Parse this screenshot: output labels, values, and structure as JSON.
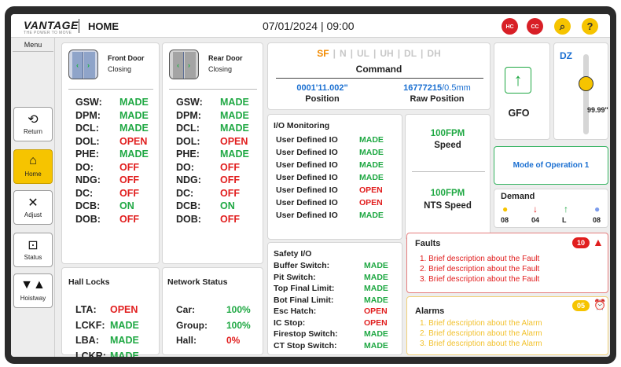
{
  "header": {
    "logo": "VANTAGE",
    "logo_sub": "THE POWER TO MOVE",
    "title": "HOME",
    "datetime": "07/01/2024 | 09:00",
    "badges": [
      {
        "label": "HC",
        "color": "#d81f26",
        "icon": "lock-icon"
      },
      {
        "label": "CC",
        "color": "#d81f26",
        "icon": "lock-icon"
      },
      {
        "label": "⌕",
        "color": "#f6c400",
        "icon": "search-icon"
      },
      {
        "label": "?",
        "color": "#f6c400",
        "icon": "help-icon"
      }
    ]
  },
  "menu": {
    "title": "Menu",
    "items": [
      {
        "label": "Return",
        "icon": "return-icon"
      },
      {
        "label": "Home",
        "icon": "home-icon",
        "active": true
      },
      {
        "label": "Adjust",
        "icon": "tools-icon"
      },
      {
        "label": "Status",
        "icon": "status-icon"
      },
      {
        "label": "Hoistway",
        "icon": "hoistway-icon"
      }
    ]
  },
  "front_door": {
    "name": "Front Door",
    "state": "Closing",
    "signals": [
      {
        "k": "GSW:",
        "v": "MADE",
        "c": "g"
      },
      {
        "k": "DPM:",
        "v": "MADE",
        "c": "g"
      },
      {
        "k": "DCL:",
        "v": "MADE",
        "c": "g"
      },
      {
        "k": "DOL:",
        "v": "OPEN",
        "c": "r"
      },
      {
        "k": "PHE:",
        "v": "MADE",
        "c": "g"
      },
      {
        "k": "DO:",
        "v": "OFF",
        "c": "r"
      },
      {
        "k": "NDG:",
        "v": "OFF",
        "c": "r"
      },
      {
        "k": "DC:",
        "v": "OFF",
        "c": "r"
      },
      {
        "k": "DCB:",
        "v": "ON",
        "c": "g"
      },
      {
        "k": "DOB:",
        "v": "OFF",
        "c": "r"
      }
    ]
  },
  "rear_door": {
    "name": "Rear Door",
    "state": "Closing",
    "signals": [
      {
        "k": "GSW:",
        "v": "MADE",
        "c": "g"
      },
      {
        "k": "DPM:",
        "v": "MADE",
        "c": "g"
      },
      {
        "k": "DCL:",
        "v": "MADE",
        "c": "g"
      },
      {
        "k": "DOL:",
        "v": "OPEN",
        "c": "r"
      },
      {
        "k": "PHE:",
        "v": "MADE",
        "c": "g"
      },
      {
        "k": "DO:",
        "v": "OFF",
        "c": "r"
      },
      {
        "k": "NDG:",
        "v": "OFF",
        "c": "r"
      },
      {
        "k": "DC:",
        "v": "OFF",
        "c": "r"
      },
      {
        "k": "DCB:",
        "v": "ON",
        "c": "g"
      },
      {
        "k": "DOB:",
        "v": "OFF",
        "c": "r"
      }
    ]
  },
  "hall_locks": {
    "title": "Hall Locks",
    "items": [
      {
        "k": "LTA:",
        "v": "OPEN",
        "c": "r"
      },
      {
        "k": "LCKF:",
        "v": "MADE",
        "c": "g"
      },
      {
        "k": "LBA:",
        "v": "MADE",
        "c": "g"
      },
      {
        "k": "LCKR:",
        "v": "MADE",
        "c": "g"
      }
    ]
  },
  "network": {
    "title": "Network Status",
    "items": [
      {
        "k": "Car:",
        "v": "100%",
        "c": "g"
      },
      {
        "k": "Group:",
        "v": "100%",
        "c": "g"
      },
      {
        "k": "Hall:",
        "v": "0%",
        "c": "r"
      }
    ]
  },
  "command": {
    "modes": [
      "SF",
      "N",
      "UL",
      "UH",
      "DL",
      "DH"
    ],
    "active_mode": "SF",
    "label": "Command",
    "position_value": "0001'11.002\"",
    "position_label": "Position",
    "raw_value": "16777215",
    "raw_unit": "/0.5mm",
    "raw_label": "Raw Position"
  },
  "io_monitoring": {
    "title": "I/O Monitoring",
    "items": [
      {
        "k": "User Defined IO",
        "v": "MADE",
        "c": "g"
      },
      {
        "k": "User Defined IO",
        "v": "MADE",
        "c": "g"
      },
      {
        "k": "User Defined IO",
        "v": "MADE",
        "c": "g"
      },
      {
        "k": "User Defined IO",
        "v": "MADE",
        "c": "g"
      },
      {
        "k": "User Defined IO",
        "v": "OPEN",
        "c": "r"
      },
      {
        "k": "User Defined IO",
        "v": "OPEN",
        "c": "r"
      },
      {
        "k": "User Defined IO",
        "v": "MADE",
        "c": "g"
      }
    ]
  },
  "speed": {
    "value": "100FPM",
    "label": "Speed",
    "nts_value": "100FPM",
    "nts_label": "NTS Speed"
  },
  "gfo": {
    "label": "GFO",
    "icon": "arrow-up-icon"
  },
  "dz": {
    "label": "DZ",
    "value": "99.99\"",
    "level": 0.3
  },
  "mode": {
    "label": "Mode of Operation 1"
  },
  "demand": {
    "title": "Demand",
    "items": [
      {
        "icon": "yellow-dot-icon",
        "glyph": "●",
        "color": "#f6c400",
        "value": "08"
      },
      {
        "icon": "arrow-down-icon",
        "glyph": "↓",
        "color": "#e11e1e",
        "value": "04"
      },
      {
        "icon": "arrow-up-icon",
        "glyph": "↑",
        "color": "#1fa843",
        "value": "L"
      },
      {
        "icon": "blue-dot-icon",
        "glyph": "●",
        "color": "#7c9cec",
        "value": "08"
      }
    ]
  },
  "safety": {
    "title": "Safety I/O",
    "items": [
      {
        "k": "Buffer Switch:",
        "v": "MADE",
        "c": "g"
      },
      {
        "k": "Pit Switch:",
        "v": "MADE",
        "c": "g"
      },
      {
        "k": "Top Final Limit:",
        "v": "MADE",
        "c": "g"
      },
      {
        "k": "Bot Final Limit:",
        "v": "MADE",
        "c": "g"
      },
      {
        "k": "Esc Hatch:",
        "v": "OPEN",
        "c": "r"
      },
      {
        "k": "IC Stop:",
        "v": "OPEN",
        "c": "r"
      },
      {
        "k": "Firestop Switch:",
        "v": "MADE",
        "c": "g"
      },
      {
        "k": "CT Stop Switch:",
        "v": "MADE",
        "c": "g"
      }
    ]
  },
  "faults": {
    "title": "Faults",
    "count": "10",
    "items": [
      "1. Brief description about the Fault",
      "2. Brief description about the Fault",
      "3. Brief description about the Fault"
    ]
  },
  "alarms": {
    "title": "Alarms",
    "count": "05",
    "items": [
      "1. Brief description about the Alarm",
      "2. Brief description about the Alarm",
      "3. Brief description about the Alarm"
    ]
  }
}
